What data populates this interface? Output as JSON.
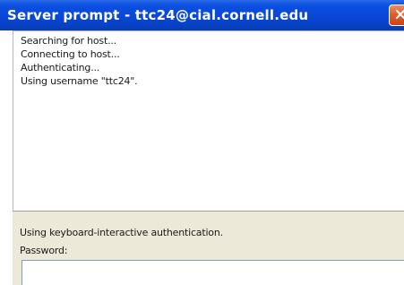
{
  "window": {
    "title": "Server prompt - ttc24@cial.cornell.edu",
    "close_icon": "close-icon"
  },
  "output": {
    "lines": [
      "Searching for host...",
      "Connecting to host...",
      "Authenticating...",
      "Using username \"ttc24\"."
    ]
  },
  "prompt": {
    "auth_message": "Using keyboard-interactive authentication.",
    "password_label": "Password:",
    "password_value": ""
  },
  "colors": {
    "titlebar": "#0a48d8",
    "close_button": "#e05a2a",
    "panel_background": "#ece9d8"
  }
}
